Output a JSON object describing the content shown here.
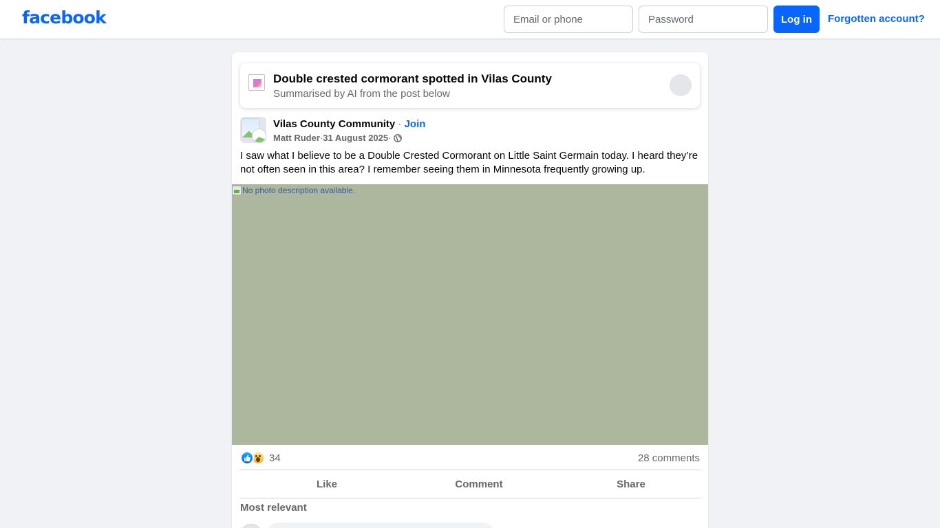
{
  "header": {
    "logo": "facebook",
    "email_placeholder": "Email or phone",
    "password_placeholder": "Password",
    "login_label": "Log in",
    "forgot_label": "Forgotten account?"
  },
  "ai_summary": {
    "title": "Double crested cormorant spotted in Vilas County",
    "subtitle": "Summarised by AI from the post below"
  },
  "post": {
    "group_name": "Vilas County Community",
    "separator": " · ",
    "join_label": "Join",
    "author": "Matt Ruder",
    "date": "31 August 2025",
    "text": "I saw what I believe to be a Double Crested Cormorant on Little Saint Germain today. I heard they’re not often seen in this area? I remember seeing them in Minnesota frequently growing up.",
    "image_alt": "No photo description available.",
    "reaction_count": "34",
    "comments_count": "28 comments",
    "actions": {
      "like": "Like",
      "comment": "Comment",
      "share": "Share"
    },
    "sort_label": "Most relevant"
  },
  "icons": {
    "ai": "ai-summary-icon",
    "globe": "globe-icon",
    "like": "like-reaction-icon",
    "wow": "wow-reaction-icon"
  },
  "colors": {
    "brand": "#0866ff",
    "background": "#f0f2f5",
    "secondary_text": "#65676b",
    "photo_placeholder": "#acb79e"
  }
}
